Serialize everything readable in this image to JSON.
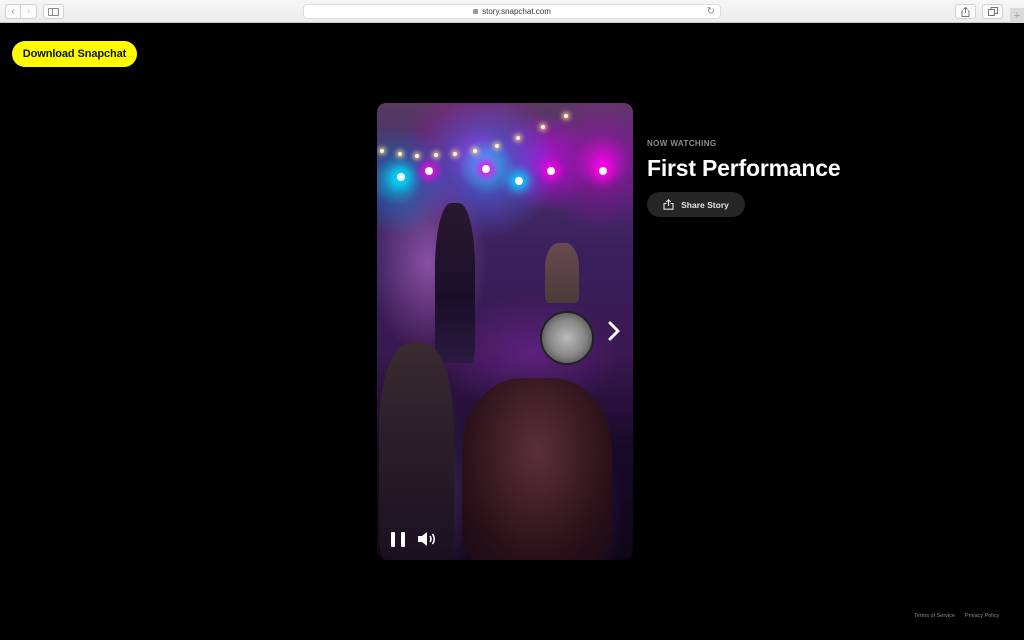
{
  "browser": {
    "url": "story.snapchat.com",
    "back_icon": "‹",
    "forward_icon": "›",
    "reload_icon": "↻",
    "new_tab_icon": "+"
  },
  "header": {
    "download_label": "Download Snapchat",
    "brand_color": "#fffc00"
  },
  "player": {
    "next_icon": "chevron-right",
    "pause_icon": "pause",
    "volume_icon": "volume"
  },
  "story": {
    "eyebrow": "NOW WATCHING",
    "title": "First Performance",
    "share_label": "Share Story"
  },
  "footer": {
    "terms": "Terms of Service",
    "privacy": "Privacy Policy"
  }
}
